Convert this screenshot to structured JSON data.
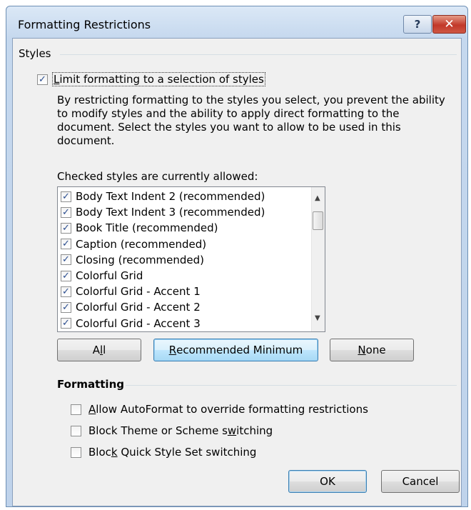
{
  "dialog": {
    "title": "Formatting Restrictions",
    "help_glyph": "?",
    "close_glyph": "✕"
  },
  "styles_group": {
    "label": "Styles",
    "limit_checkbox": {
      "label_first": "L",
      "label_rest": "imit formatting to a selection of styles",
      "checked": true
    },
    "description": "By restricting formatting to the styles you select, you prevent the ability to modify styles and the ability to apply direct formatting to the document. Select the styles you want to allow to be used in this document.",
    "list_caption": "Checked styles are currently allowed:",
    "styles": [
      {
        "label": "Body Text Indent 2 (recommended)",
        "checked": true
      },
      {
        "label": "Body Text Indent 3 (recommended)",
        "checked": true
      },
      {
        "label": "Book Title (recommended)",
        "checked": true
      },
      {
        "label": "Caption (recommended)",
        "checked": true
      },
      {
        "label": "Closing (recommended)",
        "checked": true
      },
      {
        "label": "Colorful Grid",
        "checked": true
      },
      {
        "label": "Colorful Grid - Accent 1",
        "checked": true
      },
      {
        "label": "Colorful Grid - Accent 2",
        "checked": true
      },
      {
        "label": "Colorful Grid - Accent 3",
        "checked": true
      }
    ],
    "buttons": {
      "all": {
        "pre": "A",
        "acc": "l",
        "post": "l"
      },
      "recommended": {
        "pre": "",
        "acc": "R",
        "post": "ecommended Minimum"
      },
      "none": {
        "pre": "",
        "acc": "N",
        "post": "one"
      }
    }
  },
  "formatting_group": {
    "label": "Formatting",
    "options": [
      {
        "pre": "",
        "acc": "A",
        "post": "llow AutoFormat to override formatting restrictions",
        "checked": false
      },
      {
        "pre": "Block Theme or Scheme s",
        "acc": "w",
        "post": "itching",
        "checked": false
      },
      {
        "pre": "Bloc",
        "acc": "k",
        "post": " Quick Style Set switching",
        "checked": false
      }
    ]
  },
  "footer": {
    "ok_label": "OK",
    "cancel_label": "Cancel"
  },
  "icons": {
    "check": "✓",
    "scroll_up": "▲",
    "scroll_down": "▼"
  }
}
